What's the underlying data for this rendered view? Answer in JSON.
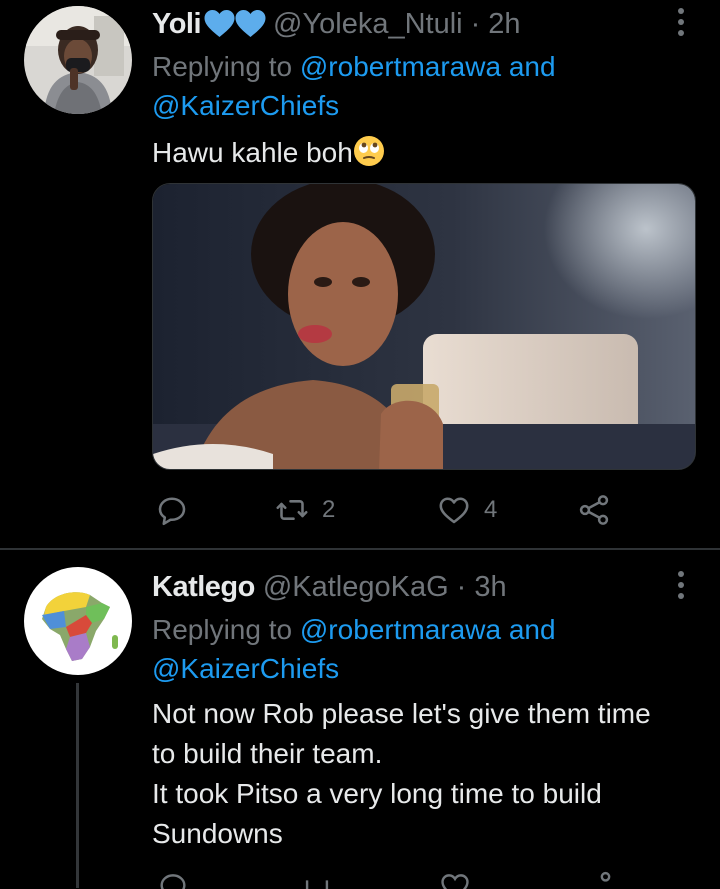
{
  "tweets": [
    {
      "display_name": "Yoli",
      "handle": "@Yoleka_Ntuli",
      "separator": "·",
      "time": "2h",
      "replying_prefix": "Replying to",
      "reply_mention_1": "@robertmarawa",
      "reply_conjunction": "and",
      "reply_mention_2": "@KaizerChiefs",
      "text": "Hawu kahle boh",
      "text_emoji": "face-with-rolling-eyes",
      "retweet_count": "2",
      "like_count": "4"
    },
    {
      "display_name": "Katlego",
      "handle": "@KatlegoKaG",
      "separator": "·",
      "time": "3h",
      "replying_prefix": "Replying to",
      "reply_mention_1": "@robertmarawa",
      "reply_conjunction": "and",
      "reply_mention_2": "@KaizerChiefs",
      "text_line_1": "Not now Rob please let's give them time",
      "text_line_2": "to build their team.",
      "text_line_3": "It took Pitso a very long time to build",
      "text_line_4": "Sundowns"
    }
  ],
  "colors": {
    "background": "#000000",
    "text_primary": "#e7e9ea",
    "text_secondary": "#71767b",
    "accent": "#1d9bf0",
    "divider": "#2f3336"
  },
  "icons": {
    "name_badge": "blue-heart-icon",
    "menu": "more-options-icon",
    "reply": "reply-icon",
    "retweet": "retweet-icon",
    "like": "heart-icon",
    "share": "share-icon"
  }
}
